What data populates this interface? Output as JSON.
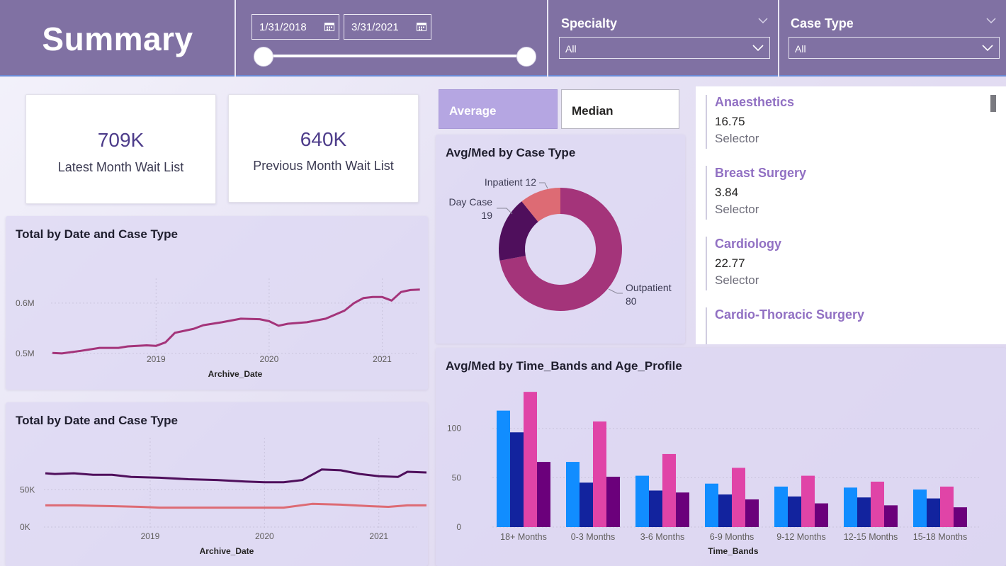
{
  "header": {
    "title": "Summary",
    "date_start": "1/31/2018",
    "date_end": "3/31/2021",
    "specialty_label": "Specialty",
    "specialty_value": "All",
    "case_type_label": "Case Type",
    "case_type_value": "All"
  },
  "kpis": [
    {
      "value": "709K",
      "label": "Latest Month Wait List"
    },
    {
      "value": "640K",
      "label": "Previous Month Wait List"
    }
  ],
  "toggle": {
    "average": "Average",
    "median": "Median",
    "active": "average"
  },
  "specialty_list": [
    {
      "name": "Anaesthetics",
      "value": "16.75",
      "sub": "Selector"
    },
    {
      "name": "Breast Surgery",
      "value": "3.84",
      "sub": "Selector"
    },
    {
      "name": "Cardiology",
      "value": "22.77",
      "sub": "Selector"
    },
    {
      "name": "Cardio-Thoracic Surgery",
      "value": "",
      "sub": ""
    }
  ],
  "colors": {
    "header": "#8071a3",
    "accent": "#4d3c8a",
    "line_total": "#a4347a",
    "line_dark": "#4f0f5c",
    "line_salmon": "#dd6b74",
    "bar1": "#118dff",
    "bar2": "#12239e",
    "bar3": "#e044a7",
    "bar4": "#6b007b"
  },
  "chart_data": [
    {
      "id": "line1",
      "type": "line",
      "title": "Total by Date and Case Type",
      "xlabel": "Archive_Date",
      "ylabel": "",
      "x_ticks": [
        "2019",
        "2020",
        "2021"
      ],
      "y_ticks": [
        "0.5M",
        "0.6M"
      ],
      "ylim": [
        0.49,
        0.635
      ],
      "series": [
        {
          "color": "#a4347a",
          "points": [
            [
              "2018-02",
              0.501
            ],
            [
              "2018-03",
              0.5
            ],
            [
              "2018-05",
              0.505
            ],
            [
              "2018-07",
              0.511
            ],
            [
              "2018-09",
              0.511
            ],
            [
              "2018-10",
              0.514
            ],
            [
              "2018-12",
              0.516
            ],
            [
              "2019-01",
              0.515
            ],
            [
              "2019-02",
              0.522
            ],
            [
              "2019-03",
              0.541
            ],
            [
              "2019-05",
              0.549
            ],
            [
              "2019-06",
              0.556
            ],
            [
              "2019-08",
              0.562
            ],
            [
              "2019-10",
              0.569
            ],
            [
              "2019-12",
              0.568
            ],
            [
              "2020-01",
              0.564
            ],
            [
              "2020-02",
              0.555
            ],
            [
              "2020-03",
              0.559
            ],
            [
              "2020-05",
              0.562
            ],
            [
              "2020-07",
              0.569
            ],
            [
              "2020-09",
              0.585
            ],
            [
              "2020-10",
              0.6
            ],
            [
              "2020-11",
              0.61
            ],
            [
              "2020-12",
              0.612
            ],
            [
              "2021-01",
              0.612
            ],
            [
              "2021-02",
              0.605
            ],
            [
              "2021-03",
              0.622
            ],
            [
              "2021-04",
              0.626
            ],
            [
              "2021-05",
              0.627
            ]
          ]
        }
      ]
    },
    {
      "id": "line2",
      "type": "line",
      "title": "Total by Date and Case Type",
      "xlabel": "Archive_Date",
      "ylabel": "",
      "x_ticks": [
        "2019",
        "2020",
        "2021"
      ],
      "y_ticks": [
        "0K",
        "50K"
      ],
      "ylim": [
        0,
        110
      ],
      "series": [
        {
          "color": "#4f0f5c",
          "points": [
            [
              "2018-02",
              72
            ],
            [
              "2018-03",
              71
            ],
            [
              "2018-05",
              72
            ],
            [
              "2018-07",
              70
            ],
            [
              "2018-09",
              70
            ],
            [
              "2018-11",
              67
            ],
            [
              "2019-02",
              66
            ],
            [
              "2019-05",
              64
            ],
            [
              "2019-08",
              63
            ],
            [
              "2019-11",
              61
            ],
            [
              "2020-01",
              60
            ],
            [
              "2020-03",
              60
            ],
            [
              "2020-05",
              63
            ],
            [
              "2020-07",
              77
            ],
            [
              "2020-09",
              76
            ],
            [
              "2020-11",
              71
            ],
            [
              "2021-01",
              68
            ],
            [
              "2021-03",
              67
            ],
            [
              "2021-04",
              74
            ],
            [
              "2021-06",
              73
            ]
          ]
        },
        {
          "color": "#dd6b74",
          "points": [
            [
              "2018-02",
              29
            ],
            [
              "2018-05",
              29
            ],
            [
              "2018-09",
              28
            ],
            [
              "2018-12",
              27
            ],
            [
              "2019-02",
              26
            ],
            [
              "2019-06",
              26
            ],
            [
              "2019-10",
              26
            ],
            [
              "2020-01",
              26
            ],
            [
              "2020-03",
              26
            ],
            [
              "2020-06",
              31
            ],
            [
              "2020-09",
              30
            ],
            [
              "2020-12",
              28
            ],
            [
              "2021-02",
              27
            ],
            [
              "2021-04",
              29
            ],
            [
              "2021-06",
              29
            ]
          ]
        }
      ]
    },
    {
      "id": "donut",
      "type": "pie",
      "title": "Avg/Med by Case Type",
      "slices": [
        {
          "label": "Outpatient",
          "value": 80,
          "color": "#a4347a"
        },
        {
          "label": "Day Case",
          "value": 19,
          "color": "#4f0f5c"
        },
        {
          "label": "Inpatient",
          "value": 12,
          "color": "#dd6b74"
        }
      ]
    },
    {
      "id": "bars",
      "type": "bar",
      "title": "Avg/Med by Time_Bands and Age_Profile",
      "xlabel": "Time_Bands",
      "ylabel": "",
      "y_ticks": [
        "0",
        "50",
        "100"
      ],
      "ylim": [
        0,
        140
      ],
      "categories": [
        "18+ Months",
        "0-3 Months",
        "3-6 Months",
        "6-9 Months",
        "9-12 Months",
        "12-15 Months",
        "15-18 Months"
      ],
      "series": [
        {
          "color": "#118dff",
          "values": [
            118,
            66,
            52,
            44,
            41,
            40,
            38
          ]
        },
        {
          "color": "#12239e",
          "values": [
            96,
            45,
            37,
            33,
            31,
            30,
            29
          ]
        },
        {
          "color": "#e044a7",
          "values": [
            137,
            107,
            74,
            60,
            52,
            46,
            41
          ]
        },
        {
          "color": "#6b007b",
          "values": [
            66,
            51,
            35,
            28,
            24,
            22,
            20
          ]
        }
      ]
    }
  ]
}
